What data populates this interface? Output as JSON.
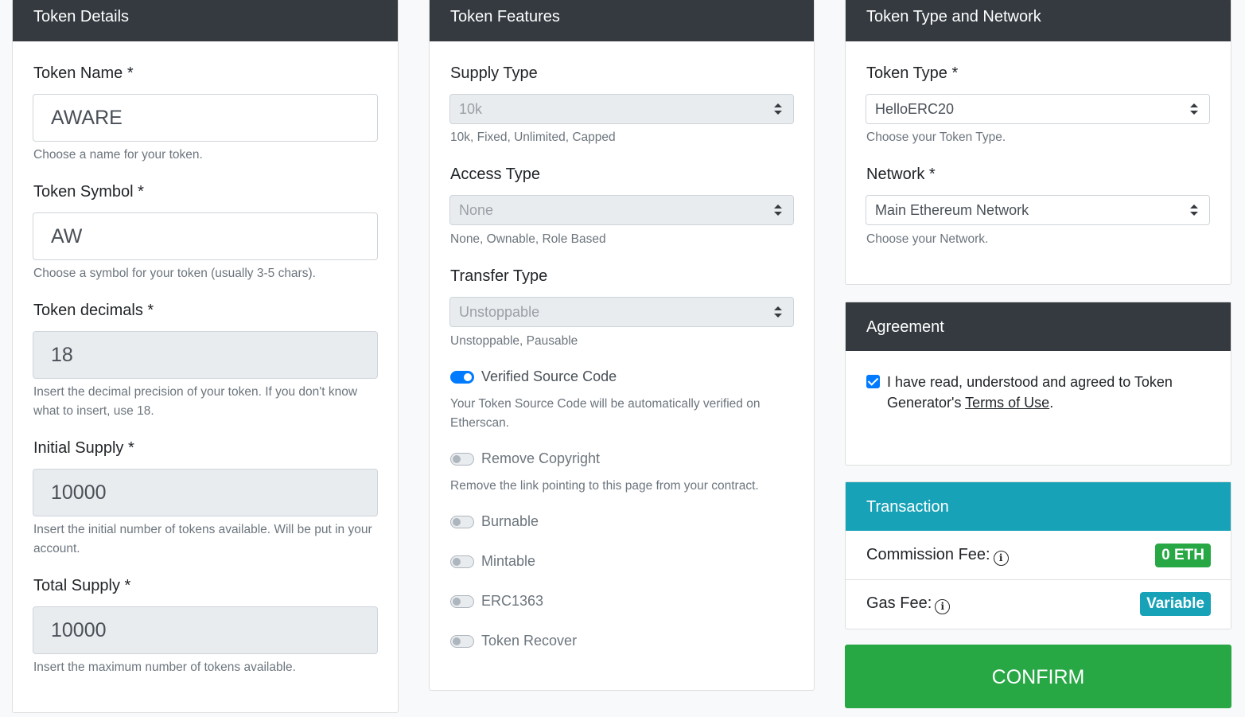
{
  "token_details": {
    "header": "Token Details",
    "name_label": "Token Name *",
    "name_value": "AWARE",
    "name_help": "Choose a name for your token.",
    "symbol_label": "Token Symbol *",
    "symbol_value": "AW",
    "symbol_help": "Choose a symbol for your token (usually 3-5 chars).",
    "decimals_label": "Token decimals *",
    "decimals_value": "18",
    "decimals_help": "Insert the decimal precision of your token. If you don't know what to insert, use 18.",
    "initial_label": "Initial Supply *",
    "initial_value": "10000",
    "initial_help": "Insert the initial number of tokens available. Will be put in your account.",
    "total_label": "Total Supply *",
    "total_value": "10000",
    "total_help": "Insert the maximum number of tokens available."
  },
  "token_features": {
    "header": "Token Features",
    "supply_label": "Supply Type",
    "supply_value": "10k",
    "supply_help": "10k, Fixed, Unlimited, Capped",
    "access_label": "Access Type",
    "access_value": "None",
    "access_help": "None, Ownable, Role Based",
    "transfer_label": "Transfer Type",
    "transfer_value": "Unstoppable",
    "transfer_help": "Unstoppable, Pausable",
    "verified_label": "Verified Source Code",
    "verified_help": "Your Token Source Code will be automatically verified on Etherscan.",
    "copyright_label": "Remove Copyright",
    "copyright_help": "Remove the link pointing to this page from your contract.",
    "burnable_label": "Burnable",
    "mintable_label": "Mintable",
    "erc1363_label": "ERC1363",
    "recover_label": "Token Recover"
  },
  "type_network": {
    "header": "Token Type and Network",
    "type_label": "Token Type *",
    "type_value": "HelloERC20",
    "type_help": "Choose your Token Type.",
    "network_label": "Network *",
    "network_value": "Main Ethereum Network",
    "network_help": "Choose your Network."
  },
  "agreement": {
    "header": "Agreement",
    "text_before": "I have read, understood and agreed to Token Generator's ",
    "link": "Terms of Use",
    "text_after": "."
  },
  "transaction": {
    "header": "Transaction",
    "commission_label": "Commission Fee:",
    "commission_value": "0 ETH",
    "gas_label": "Gas Fee:",
    "gas_value": "Variable"
  },
  "confirm_label": "CONFIRM",
  "colors": {
    "header_dark": "#343a40",
    "transaction_teal": "#17a2b8",
    "confirm_green": "#28a745",
    "badge_green": "#28a745",
    "badge_teal": "#17a2b8",
    "switch_on": "#007bff"
  }
}
